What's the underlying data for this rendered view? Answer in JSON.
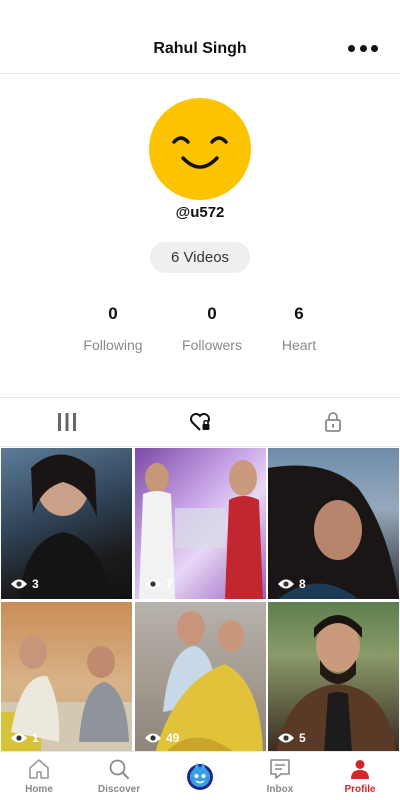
{
  "header": {
    "title": "Rahul Singh"
  },
  "profile": {
    "username": "@u572",
    "videos_label": "6 Videos",
    "stats": [
      {
        "value": "0",
        "label": "Following"
      },
      {
        "value": "0",
        "label": "Followers"
      },
      {
        "value": "6",
        "label": "Heart"
      }
    ]
  },
  "tabs": [
    {
      "icon": "grid-icon"
    },
    {
      "icon": "liked-icon"
    },
    {
      "icon": "lock-icon"
    }
  ],
  "videos": [
    {
      "views": "3"
    },
    {
      "views": "7"
    },
    {
      "views": "8"
    },
    {
      "views": "1"
    },
    {
      "views": "49"
    },
    {
      "views": "5"
    }
  ],
  "nav": [
    {
      "label": "Home",
      "icon": "home-icon"
    },
    {
      "label": "Discover",
      "icon": "search-icon"
    },
    {
      "label": "",
      "icon": "create-icon"
    },
    {
      "label": "Inbox",
      "icon": "inbox-icon"
    },
    {
      "label": "Profile",
      "icon": "profile-icon"
    }
  ],
  "colors": {
    "accent": "#d3262b",
    "avatar": "#fcc400",
    "muted": "#8a8a8a"
  }
}
